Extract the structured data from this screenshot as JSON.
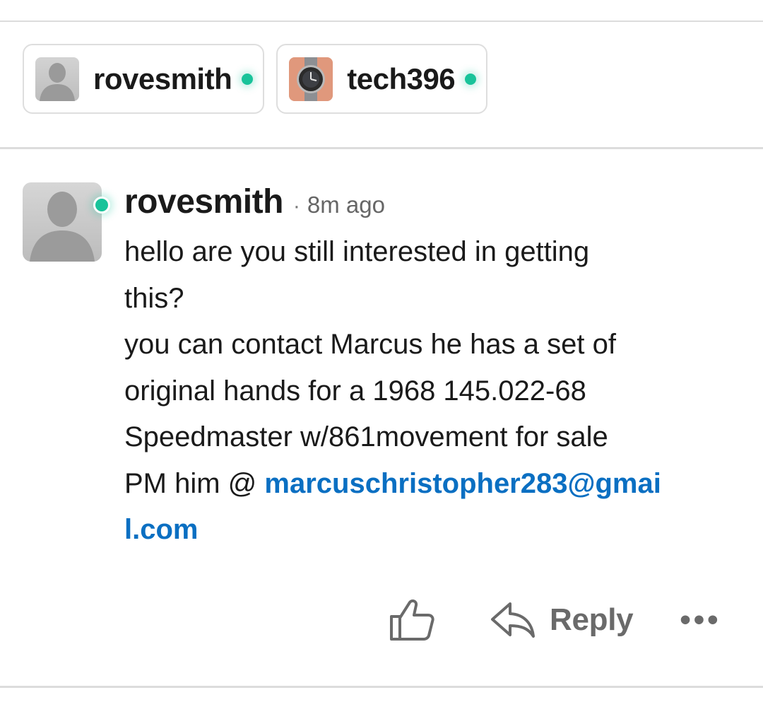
{
  "participants": [
    {
      "name": "rovesmith",
      "avatar": "default-person-avatar",
      "online": true
    },
    {
      "name": "tech396",
      "avatar": "watch-photo-avatar",
      "online": true
    }
  ],
  "comment": {
    "author": "rovesmith",
    "separator": "·",
    "time": "8m ago",
    "lines": [
      "hello are you still interested in getting",
      "this?",
      "you can contact Marcus he has a set of",
      "original hands for a 1968 145.022-68",
      "Speedmaster w/861movement for sale",
      "PM him @ "
    ],
    "link_part1": "marcuschristopher283@gmai",
    "link_part2": "l.com"
  },
  "actions": {
    "like_icon": "thumbs-up-icon",
    "reply_icon": "reply-arrow-icon",
    "reply_label": "Reply",
    "more_label": "•••"
  },
  "colors": {
    "online": "#19c39a",
    "link": "#0a6fc2",
    "action": "#6a6a6a"
  }
}
